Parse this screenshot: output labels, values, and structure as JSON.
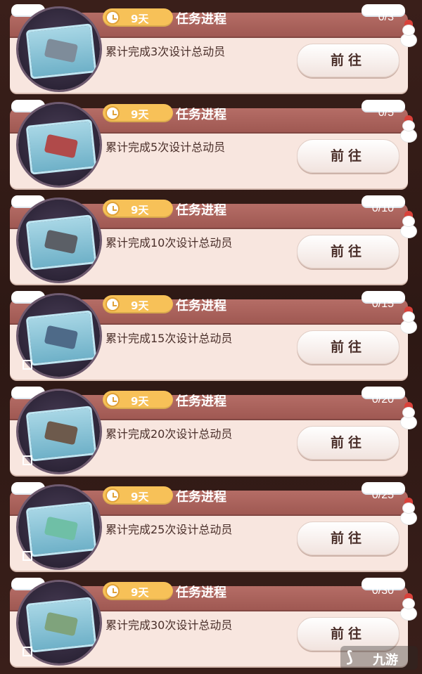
{
  "header": {
    "title": "任务进程",
    "duration": "9天",
    "go_label": "前往"
  },
  "tasks": [
    {
      "description": "累计完成3次设计总动员",
      "progress": "0/3",
      "item_icon": "blueprint-icon"
    },
    {
      "description": "累计完成5次设计总动员",
      "progress": "0/5",
      "item_icon": "blueprint-icon"
    },
    {
      "description": "累计完成10次设计总动员",
      "progress": "0/10",
      "item_icon": "blueprint-icon"
    },
    {
      "description": "累计完成15次设计总动员",
      "progress": "0/15",
      "item_icon": "blueprint-icon"
    },
    {
      "description": "累计完成20次设计总动员",
      "progress": "0/20",
      "item_icon": "blueprint-icon"
    },
    {
      "description": "累计完成25次设计总动员",
      "progress": "0/25",
      "item_icon": "blueprint-icon"
    },
    {
      "description": "累计完成30次设计总动员",
      "progress": "0/30",
      "item_icon": "blueprint-icon"
    }
  ],
  "watermark": {
    "logo_text": "九游"
  },
  "colors": {
    "header": "#a35c56",
    "body": "#f8e6df",
    "pill": "#f7c158",
    "text": "#4a2f2a"
  }
}
